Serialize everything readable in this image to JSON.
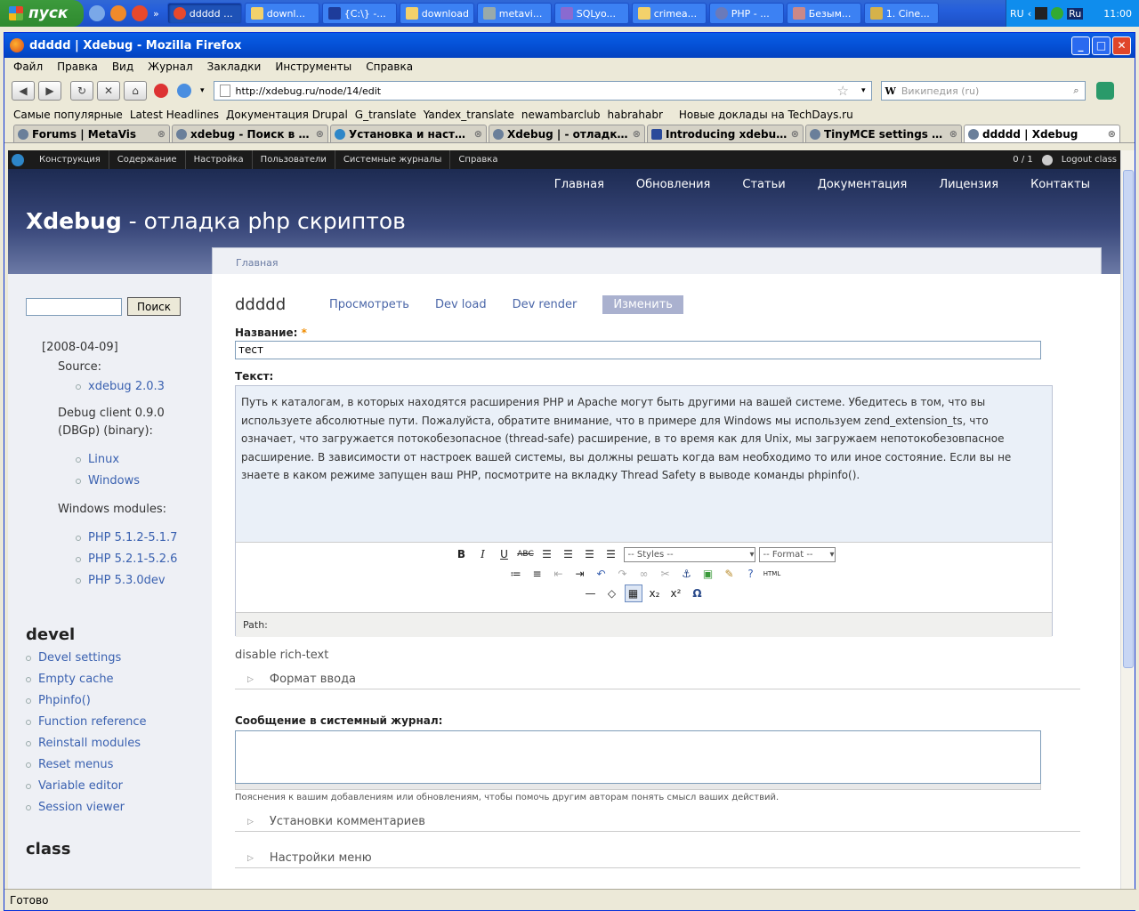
{
  "taskbar": {
    "start_label": "пуск",
    "buttons": [
      "ddddd ...",
      "downl...",
      "{C:\\} -...",
      "download",
      "metavi...",
      "SQLyo...",
      "crimea...",
      "PHP - ...",
      "Безым...",
      "1. Cine..."
    ],
    "tray_lang": "RU",
    "tray_lang2": "Ru",
    "clock": "11:00"
  },
  "window": {
    "title": "ddddd | Xdebug - Mozilla Firefox",
    "menu": [
      "Файл",
      "Правка",
      "Вид",
      "Журнал",
      "Закладки",
      "Инструменты",
      "Справка"
    ],
    "url": "http://xdebug.ru/node/14/edit",
    "search_placeholder": "Википедия (ru)",
    "search_engine_letter": "W",
    "bookmarks": [
      "Самые популярные",
      "Latest Headlines",
      "Документация Drupal",
      "G_translate",
      "Yandex_translate",
      "newambarclub",
      "habrahabr",
      "Новые доклады на TechDays.ru"
    ],
    "tabs": [
      "Forums | MetaVis",
      "xdebug - Поиск в Goo...",
      "Установка и настрой...",
      "Xdebug | - отладка ph...",
      "Introducing xdebug / ...",
      "TinyMCE settings | Xd...",
      "ddddd | Xdebug"
    ],
    "status": "Готово"
  },
  "admin": {
    "items": [
      "Конструкция",
      "Содержание",
      "Настройка",
      "Пользователи",
      "Системные журналы",
      "Справка"
    ],
    "users_count": "0 / 1",
    "logout": "Logout class"
  },
  "site": {
    "primary": [
      "Главная",
      "Обновления",
      "Статьи",
      "Документация",
      "Лицензия",
      "Контакты"
    ],
    "name_bold": "Xdebug",
    "name_rest": " - отладка php скриптов",
    "breadcrumb": "Главная"
  },
  "sidebar": {
    "search_button": "Поиск",
    "date": "[2008-04-09]",
    "source_label": "Source:",
    "source_link": "xdebug 2.0.3",
    "debug_client": "Debug client 0.9.0 (DBGp) (binary):",
    "client_links": [
      "Linux",
      "Windows"
    ],
    "modules_label": "Windows modules:",
    "module_links": [
      "PHP 5.1.2-5.1.7",
      "PHP 5.2.1-5.2.6",
      "PHP 5.3.0dev"
    ],
    "devel_heading": "devel",
    "devel_links": [
      "Devel settings",
      "Empty cache",
      "Phpinfo()",
      "Function reference",
      "Reinstall modules",
      "Reset menus",
      "Variable editor",
      "Session viewer"
    ],
    "class_heading": "class"
  },
  "node": {
    "title": "ddddd",
    "tabs": [
      "Просмотреть",
      "Dev load",
      "Dev render",
      "Изменить"
    ],
    "title_label": "Название:",
    "required_mark": "*",
    "title_value": "тест",
    "body_label": "Текст:",
    "body_text": "Путь к каталогам, в которых находятся расширения PHP и Apache могут быть другими на вашей системе. Убедитесь в том, что вы используете абсолютные пути. Пожалуйста, обратите внимание, что в примере для Windows мы используем zend_extension_ts, что означает, что загружается потокобезопасное (thread-safe) расширение, в то время как для Unix, мы загружаем непотокобезовпасное расширение. В зависимости от настроек вашей системы, вы должны решать когда вам необходимо то или иное состояние. Если вы не знаете в каком режиме запущен ваш PHP, посмотрите на вкладку Thread Safety в выводе команды phpinfo().",
    "styles_select": "-- Styles --",
    "format_select": "-- Format --",
    "path_label": "Path:",
    "disable_rich": "disable rich-text",
    "input_format": "Формат ввода",
    "log_label": "Сообщение в системный журнал:",
    "log_desc": "Пояснения к вашим добавлениям или обновлениям, чтобы помочь другим авторам понять смысл ваших действий.",
    "comment_settings": "Установки комментариев",
    "menu_settings": "Настройки меню"
  }
}
